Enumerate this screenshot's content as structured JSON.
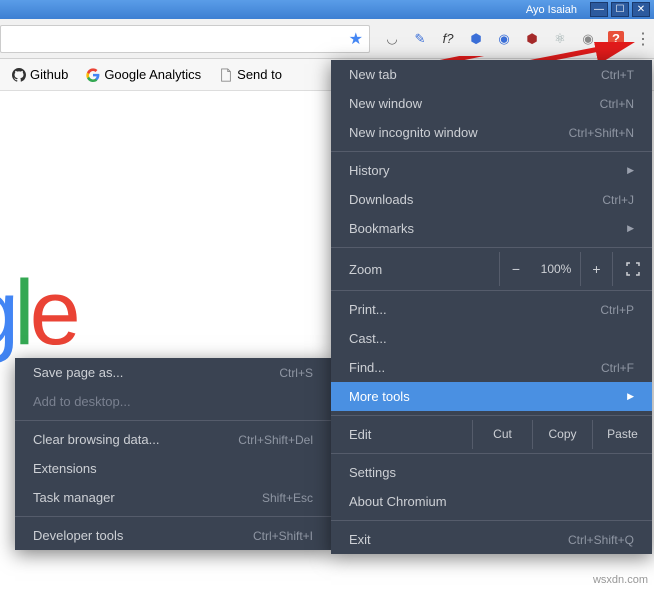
{
  "window": {
    "user": "Ayo Isaiah",
    "min": "—",
    "max": "☐",
    "close": "✕"
  },
  "bookmarks": {
    "github": "Github",
    "ga": "Google Analytics",
    "sendto": "Send to"
  },
  "logo": {
    "g1": "g",
    "l1": "l",
    "e1": "e"
  },
  "menu": {
    "newtab": "New tab",
    "newtab_sc": "Ctrl+T",
    "newwin": "New window",
    "newwin_sc": "Ctrl+N",
    "incog": "New incognito window",
    "incog_sc": "Ctrl+Shift+N",
    "history": "History",
    "downloads": "Downloads",
    "downloads_sc": "Ctrl+J",
    "bookmarks": "Bookmarks",
    "zoom": "Zoom",
    "zoom_val": "100%",
    "print": "Print...",
    "print_sc": "Ctrl+P",
    "cast": "Cast...",
    "find": "Find...",
    "find_sc": "Ctrl+F",
    "moretools": "More tools",
    "edit": "Edit",
    "cut": "Cut",
    "copy": "Copy",
    "paste": "Paste",
    "settings": "Settings",
    "about": "About Chromium",
    "exit": "Exit",
    "exit_sc": "Ctrl+Shift+Q"
  },
  "submenu": {
    "savepage": "Save page as...",
    "savepage_sc": "Ctrl+S",
    "addtodesktop": "Add to desktop...",
    "clearbrowsing": "Clear browsing data...",
    "clearbrowsing_sc": "Ctrl+Shift+Del",
    "extensions": "Extensions",
    "taskmgr": "Task manager",
    "taskmgr_sc": "Shift+Esc",
    "devtools": "Developer tools",
    "devtools_sc": "Ctrl+Shift+I"
  },
  "watermark": "wsxdn.com"
}
